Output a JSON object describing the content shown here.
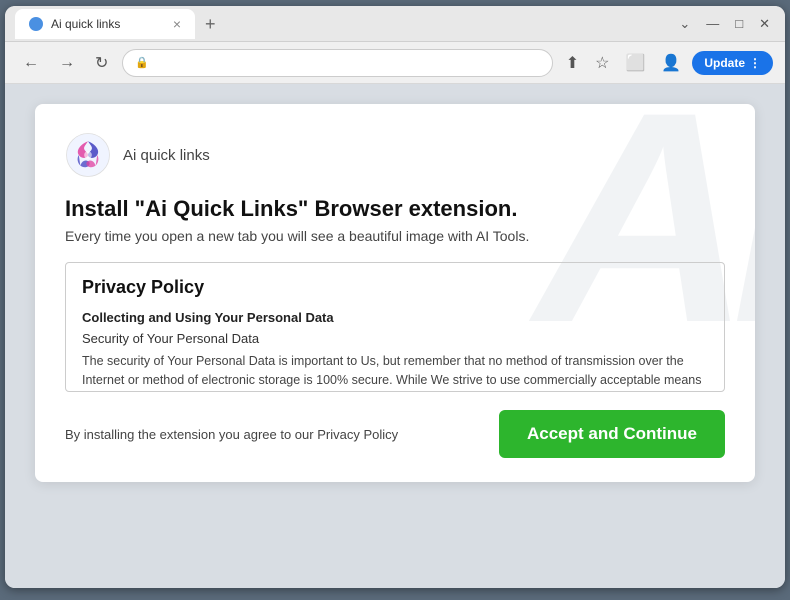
{
  "browser": {
    "tab_title": "Ai quick links",
    "new_tab_label": "+",
    "close_label": "×",
    "nav_back": "←",
    "nav_forward": "→",
    "nav_refresh": "↻",
    "update_button_label": "Update",
    "minimize_label": "—",
    "maximize_label": "□",
    "close_window_label": "✕",
    "chevron_label": "⌄"
  },
  "extension": {
    "name": "Ai quick links",
    "install_title": "Install \"Ai Quick Links\" Browser extension.",
    "install_subtitle": "Every time you open a new tab you will see a beautiful image with AI Tools.",
    "policy_title": "Privacy Policy",
    "policy_section": "Collecting and Using Your Personal Data",
    "policy_subsection": "Security of Your Personal Data",
    "policy_text": "The security of Your Personal Data is important to Us, but remember that no method of transmission over the Internet or method of electronic storage is 100% secure. While We strive to use commercially acceptable means to protect Your Personal Data, We cannot guarantee its absolute security.",
    "accept_button_label": "Accept and Continue",
    "footer_note": "By installing the extension you agree to our Privacy Policy"
  },
  "colors": {
    "accept_btn_bg": "#2db52d",
    "update_btn_bg": "#1a73e8"
  }
}
